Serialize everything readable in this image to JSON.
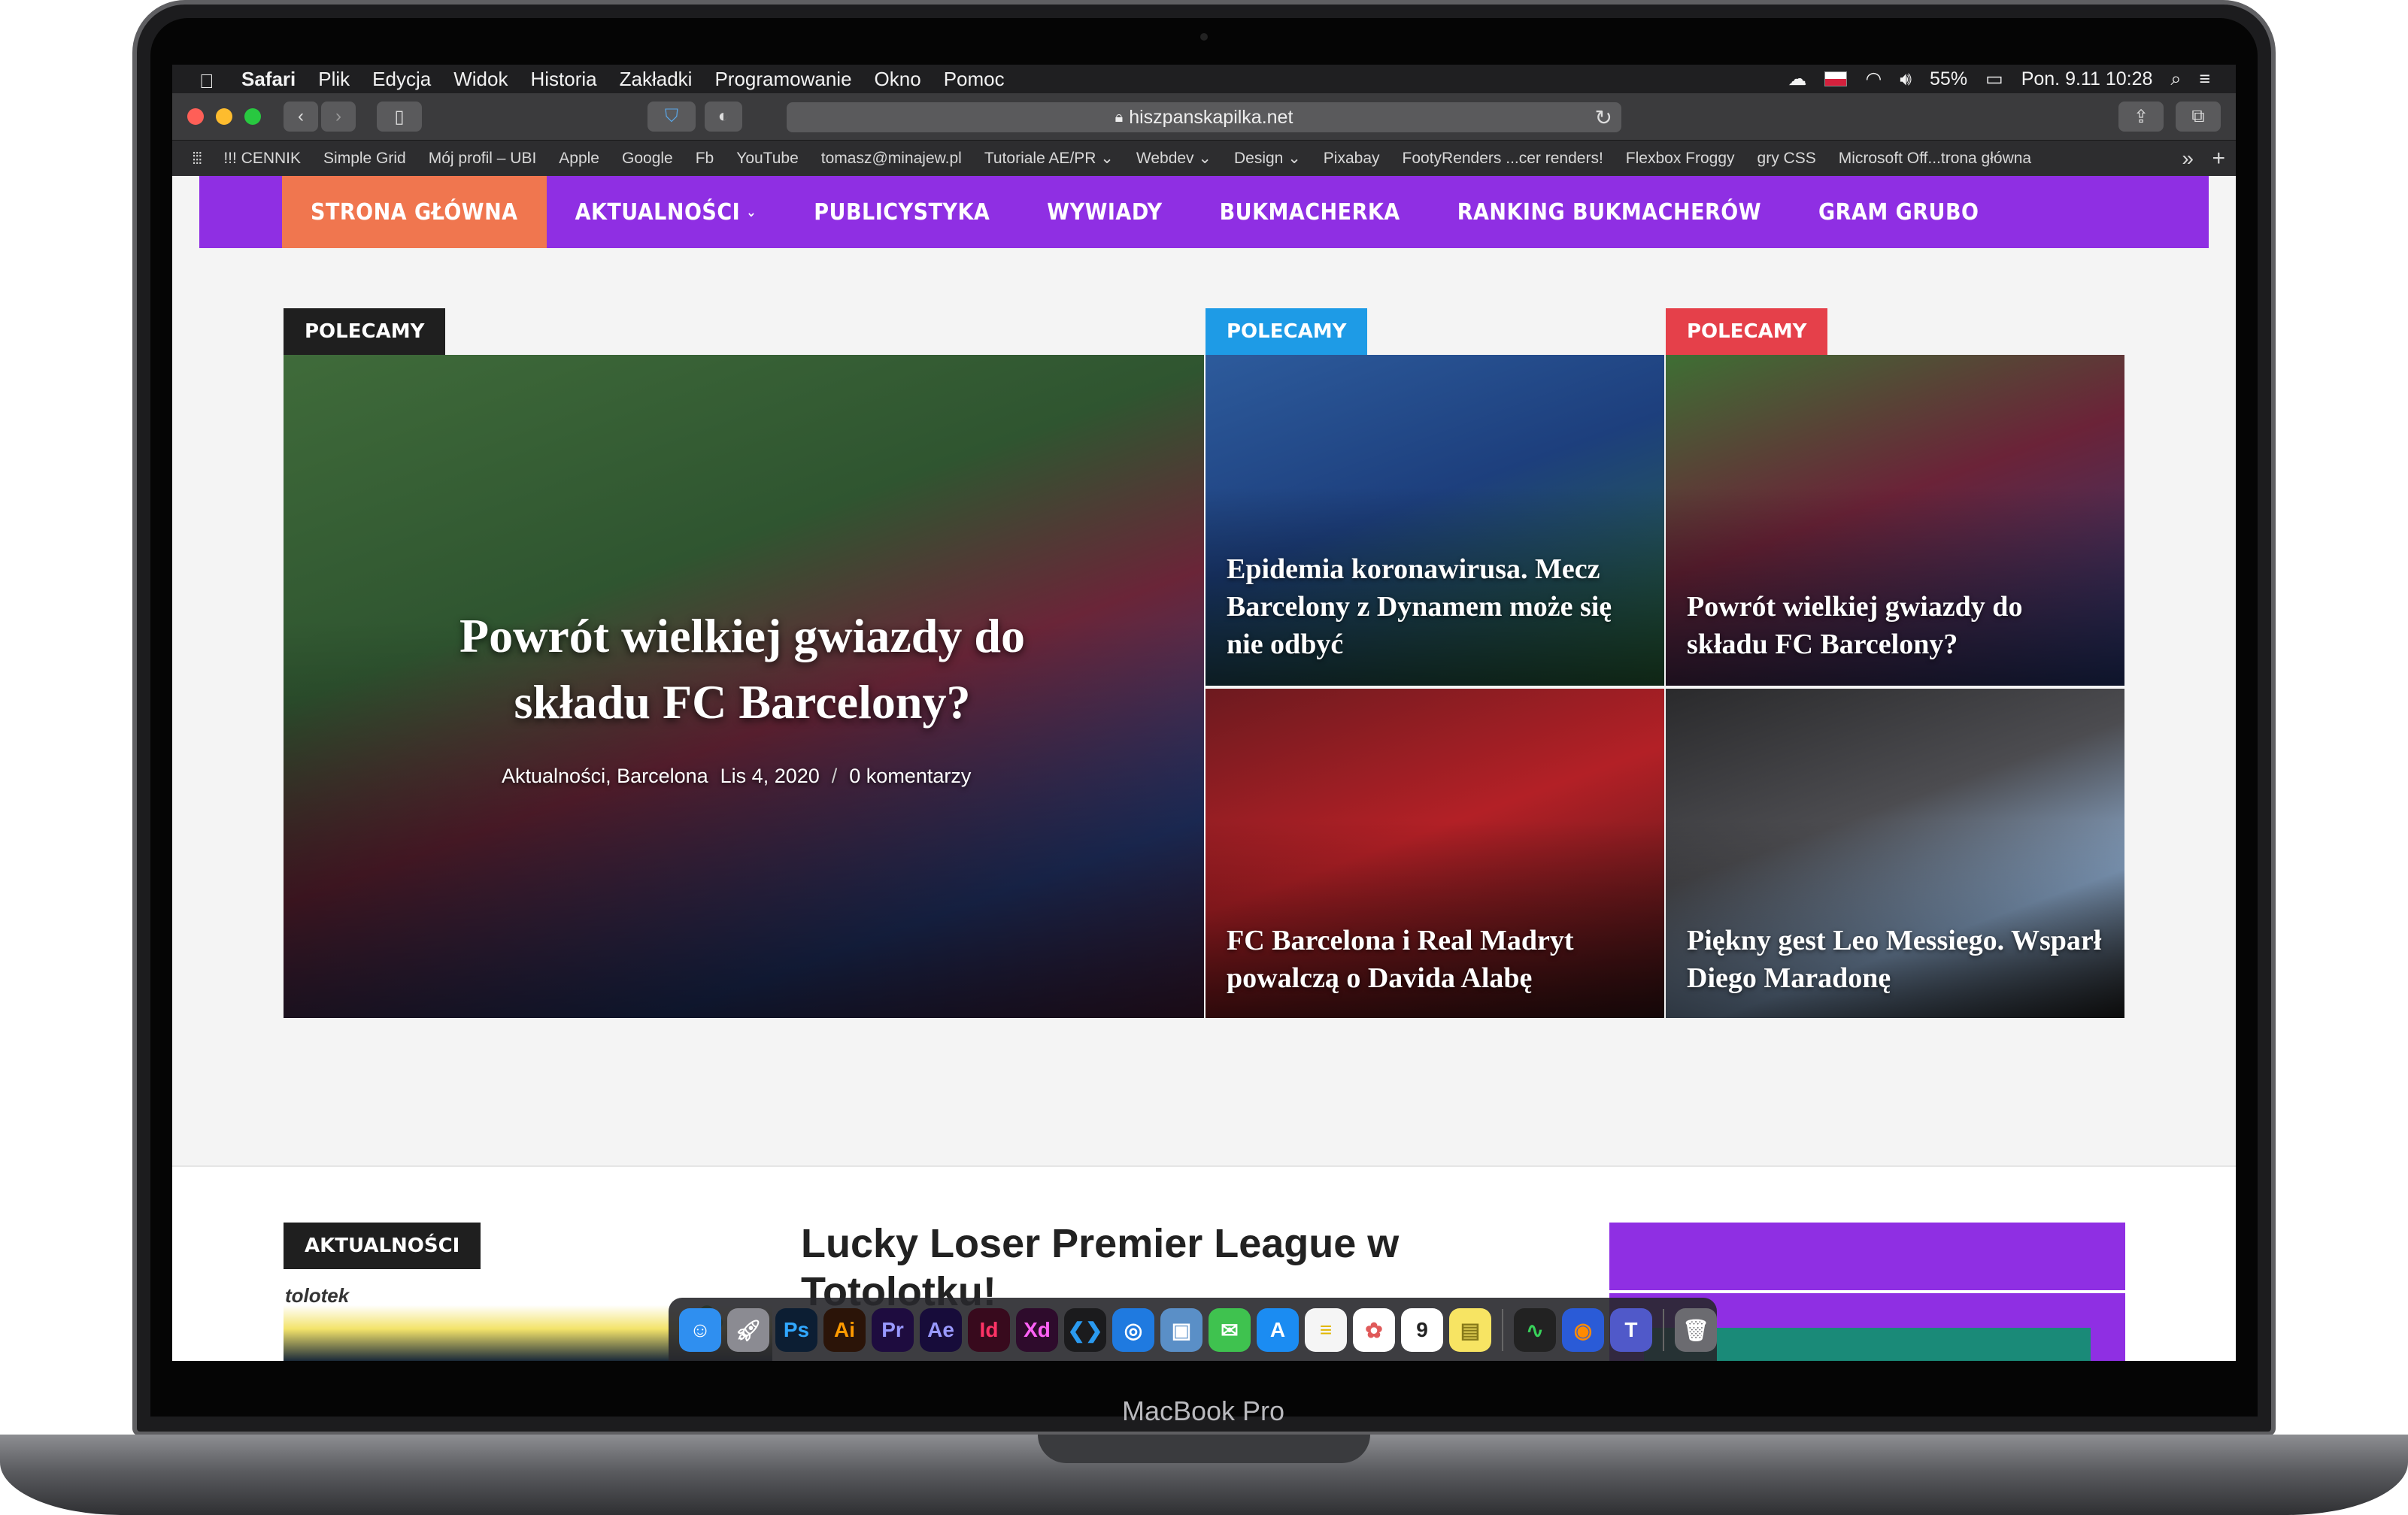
{
  "device": {
    "brand": "MacBook Pro"
  },
  "menubar": {
    "app": "Safari",
    "items": [
      "Plik",
      "Edycja",
      "Widok",
      "Historia",
      "Zakładki",
      "Programowanie",
      "Okno",
      "Pomoc"
    ],
    "battery": "55%",
    "clock": "Pon. 9.11  10:28"
  },
  "toolbar": {
    "url": "hiszpanskapilka.net"
  },
  "bookmarks": [
    "!!! CENNIK",
    "Simple Grid",
    "Mój profil – UBI",
    "Apple",
    "Google",
    "Fb",
    "YouTube",
    "tomasz@minajew.pl",
    "Tutoriale AE/PR ⌄",
    "Webdev ⌄",
    "Design ⌄",
    "Pixabay",
    "FootyRenders ...cer renders!",
    "Flexbox Froggy",
    "gry CSS",
    "Microsoft Off...trona główna"
  ],
  "nav": {
    "items": [
      "STRONA GŁÓWNA",
      "AKTUALNOŚCI",
      "PUBLICYSTYKA",
      "WYWIADY",
      "BUKMACHERKA",
      "RANKING BUKMACHERÓW",
      "GRAM GRUBO"
    ]
  },
  "featured": {
    "tag": "POLECAMY",
    "title": "Powrót wielkiej gwiazdy do składu FC Barcelony?",
    "category": "Aktualności, Barcelona",
    "date": "Lis 4, 2020",
    "comments": "0 komentarzy"
  },
  "tiles": [
    {
      "tag": "POLECAMY",
      "title": "Epidemia koronawirusa. Mecz Barcelony z Dynamem może się nie odbyć"
    },
    {
      "tag": "POLECAMY",
      "title": "Powrót wielkiej gwiazdy do składu FC Barcelony?"
    },
    {
      "title": "FC Barcelona i Real Madryt powalczą o Davida Alabę"
    },
    {
      "title": "Piękny gest Leo Messiego. Wsparł Diego Maradonę"
    }
  ],
  "news": {
    "tag": "AKTUALNOŚCI",
    "title": "Lucky Loser Premier League w Totolotku!",
    "thumb_text": "tolotek"
  },
  "dock": [
    "Finder",
    "Launchpad",
    "Ps",
    "Ai",
    "Pr",
    "Ae",
    "Id",
    "Xd",
    "VS Code",
    "Safari",
    "Preview",
    "Messages",
    "App Store",
    "Notes",
    "Photos",
    "Calendar",
    "Stickies",
    "Activity Monitor",
    "Firefox",
    "Teams",
    "Trash"
  ],
  "colors": {
    "nav": "#8f2fe3",
    "nav_active": "#f0764f",
    "tag_blue": "#1e9be6",
    "tag_red": "#e5404a"
  }
}
